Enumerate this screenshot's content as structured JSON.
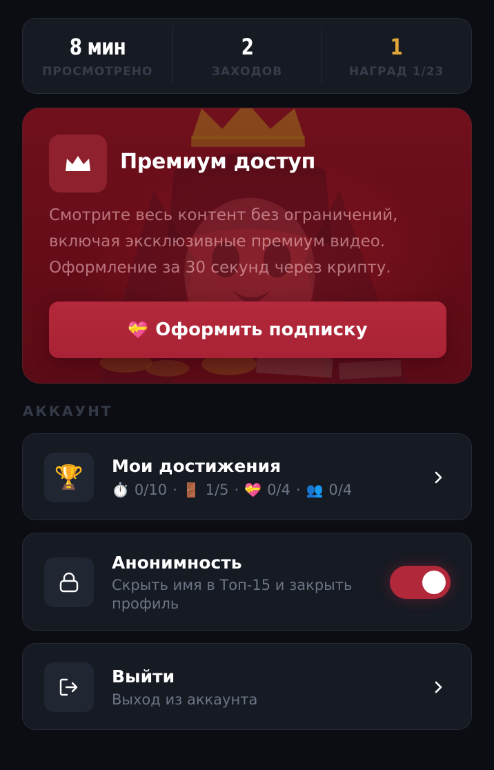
{
  "stats": [
    {
      "value": "8 мин",
      "label": "ПРОСМОТРЕНО"
    },
    {
      "value": "2",
      "label": "ЗАХОДОВ"
    },
    {
      "value": "1",
      "label": "НАГРАД 1/23"
    }
  ],
  "premium": {
    "title": "Премиум доступ",
    "description": "Смотрите весь контент без ограничений, включая эксклюзивные премиум видео. Оформление за 30 секунд через крипту.",
    "button_emoji": "💝",
    "button_label": "Оформить подписку",
    "icon": "crown-icon"
  },
  "account": {
    "section_title": "АККАУНТ",
    "achievements": {
      "title": "Мои достижения",
      "icon": "trophy-icon",
      "stats": [
        {
          "emoji": "⏱️",
          "value": "0/10"
        },
        {
          "emoji": "🚪",
          "value": "1/5"
        },
        {
          "emoji": "💝",
          "value": "0/4"
        },
        {
          "emoji": "👥",
          "value": "0/4"
        }
      ],
      "separator": "·"
    },
    "anonymity": {
      "title": "Анонимность",
      "subtitle": "Скрыть имя в Топ-15 и закрыть профиль",
      "icon": "lock-icon",
      "toggle_on": true
    },
    "logout": {
      "title": "Выйти",
      "subtitle": "Выход из аккаунта",
      "icon": "logout-icon"
    }
  },
  "colors": {
    "background": "#0b0d12",
    "card": "#161a23",
    "accent": "#b0283a",
    "gold": "#e2a73a"
  }
}
